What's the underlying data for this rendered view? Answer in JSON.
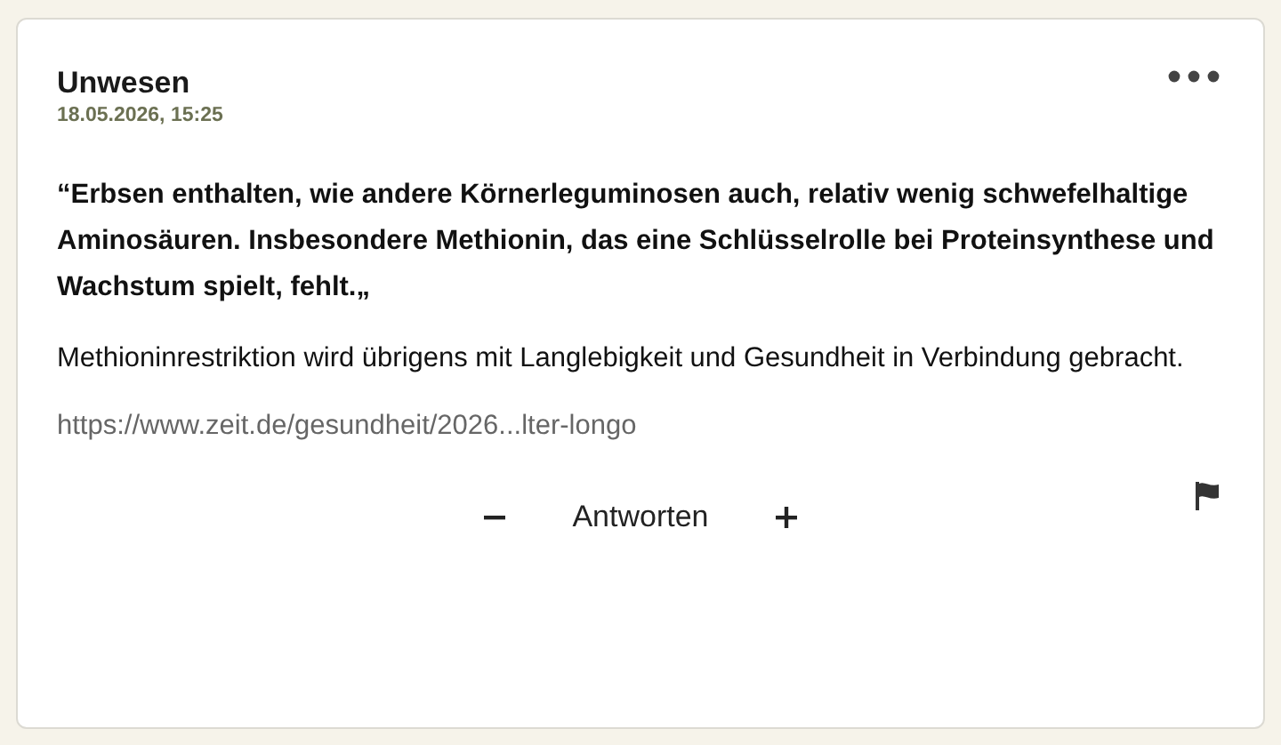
{
  "comment": {
    "author": "Unwesen",
    "timestamp": "18.05.2026, 15:25",
    "quote": "“Erbsen enthalten, wie andere Körnerleguminosen auch, relativ wenig schwefelhaltige Aminosäuren. Insbesondere Methionin, das eine Schlüsselrolle bei Proteinsynthese und Wachstum spielt, fehlt.„",
    "body": "Methioninrestriktion wird übrigens mit Langlebigkeit und Gesundheit in Verbindung gebracht.",
    "link": "https://www.zeit.de/gesundheit/2026...lter-longo"
  },
  "actions": {
    "reply": "Antworten"
  }
}
